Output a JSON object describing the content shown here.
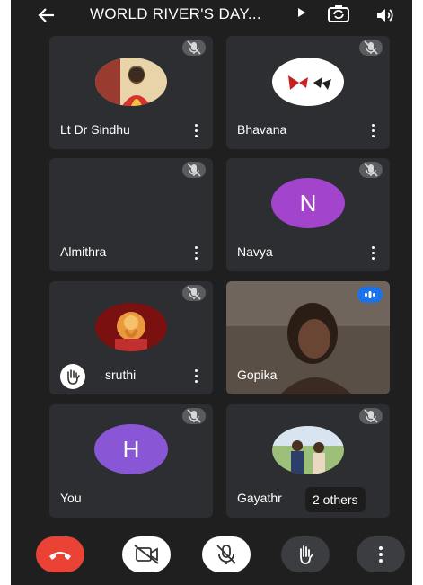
{
  "header": {
    "title": "WORLD RIVER'S DAY...",
    "icons": {
      "back": "arrow-left-icon",
      "caret": "play-caret-icon",
      "switch_camera": "camera-switch-icon",
      "speaker": "speaker-icon"
    }
  },
  "participants": [
    {
      "name": "Lt Dr Sindhu",
      "muted": true,
      "avatar": "photo"
    },
    {
      "name": "Bhavana",
      "muted": true,
      "avatar": "butterflies-photo"
    },
    {
      "name": "Almithra",
      "muted": true,
      "avatar": "none"
    },
    {
      "name": "Navya",
      "muted": true,
      "avatar_letter": "N"
    },
    {
      "name": "sruthi",
      "muted": true,
      "avatar": "ganesha-photo",
      "hand_raised": true
    },
    {
      "name": "Gopika",
      "speaking": true,
      "avatar": "video"
    },
    {
      "name": "You",
      "muted": true,
      "avatar_letter": "H"
    },
    {
      "name": "Gayathr",
      "muted": true,
      "avatar": "group-photo",
      "others_label": "2 others"
    }
  ],
  "controls": {
    "end_call": "phone-hangup-icon",
    "camera": "video-off-icon",
    "mic": "mic-off-icon",
    "raise_hand": "hand-icon",
    "more": "more-vert-icon"
  },
  "colors": {
    "background": "#1f1f1f",
    "tile": "#2d2e31",
    "end_call": "#ea4335",
    "speaking": "#1a73e8",
    "avatar_n": "#a344cc",
    "avatar_h": "#8957d6"
  }
}
